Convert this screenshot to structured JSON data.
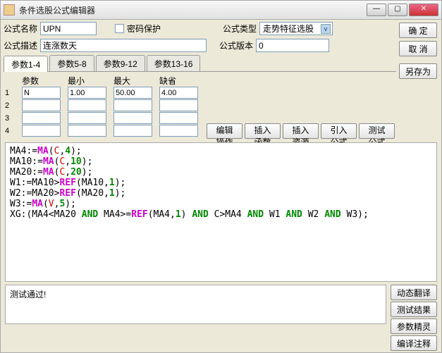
{
  "window": {
    "title": "条件选股公式编辑器"
  },
  "labels": {
    "name": "公式名称",
    "desc": "公式描述",
    "pwd": "密码保护",
    "type": "公式类型",
    "ver": "公式版本"
  },
  "fields": {
    "name": "UPN",
    "desc": "连涨数天",
    "type": "走势特征选股",
    "ver": "0"
  },
  "buttons": {
    "ok": "确  定",
    "cancel": "取  消",
    "saveas": "另存为",
    "editop": "编辑操作",
    "insfn": "插入函数",
    "insres": "插入资源",
    "import": "引入公式",
    "test": "测试公式",
    "dyntrans": "动态翻译",
    "testres": "测试结果",
    "paramwiz": "参数精灵",
    "compile": "编译注释"
  },
  "tabs": [
    "参数1-4",
    "参数5-8",
    "参数9-12",
    "参数13-16"
  ],
  "paramHeaders": {
    "name": "参数",
    "min": "最小",
    "max": "最大",
    "def": "缺省"
  },
  "paramIdx": [
    "1",
    "2",
    "3",
    "4"
  ],
  "params": [
    {
      "name": "N",
      "min": "1.00",
      "max": "50.00",
      "def": "4.00"
    },
    {
      "name": "",
      "min": "",
      "max": "",
      "def": ""
    },
    {
      "name": "",
      "min": "",
      "max": "",
      "def": ""
    },
    {
      "name": "",
      "min": "",
      "max": "",
      "def": ""
    }
  ],
  "code": {
    "l1a": "MA4:=",
    "l1b": "MA",
    "l1c": "(",
    "l1d": "C",
    "l1e": ",",
    "l1f": "4",
    "l1g": ");",
    "l2a": "MA10:=",
    "l2b": "MA",
    "l2c": "(",
    "l2d": "C",
    "l2e": ",",
    "l2f": "10",
    "l2g": ");",
    "l3a": "MA20:=",
    "l3b": "MA",
    "l3c": "(",
    "l3d": "C",
    "l3e": ",",
    "l3f": "20",
    "l3g": ");",
    "l4a": "W1:=MA10>",
    "l4b": "REF",
    "l4c": "(MA10,",
    "l4d": "1",
    "l4e": ");",
    "l5a": "W2:=MA20>",
    "l5b": "REF",
    "l5c": "(MA20,",
    "l5d": "1",
    "l5e": ");",
    "l6a": "W3:=",
    "l6b": "MA",
    "l6c": "(",
    "l6d": "V",
    "l6e": ",",
    "l6f": "5",
    "l6g": ");",
    "l7a": "XG:(MA4<MA20 ",
    "l7b": "AND",
    "l7c": " MA4>=",
    "l7d": "REF",
    "l7e": "(MA4,",
    "l7f": "1",
    "l7g": ") ",
    "l7h": "AND",
    "l7i": " C>MA4 ",
    "l7j": "AND",
    "l7k": " W1 ",
    "l7l": "AND",
    "l7m": " W2 ",
    "l7n": "AND",
    "l7o": " W3);"
  },
  "status": "测试通过!"
}
